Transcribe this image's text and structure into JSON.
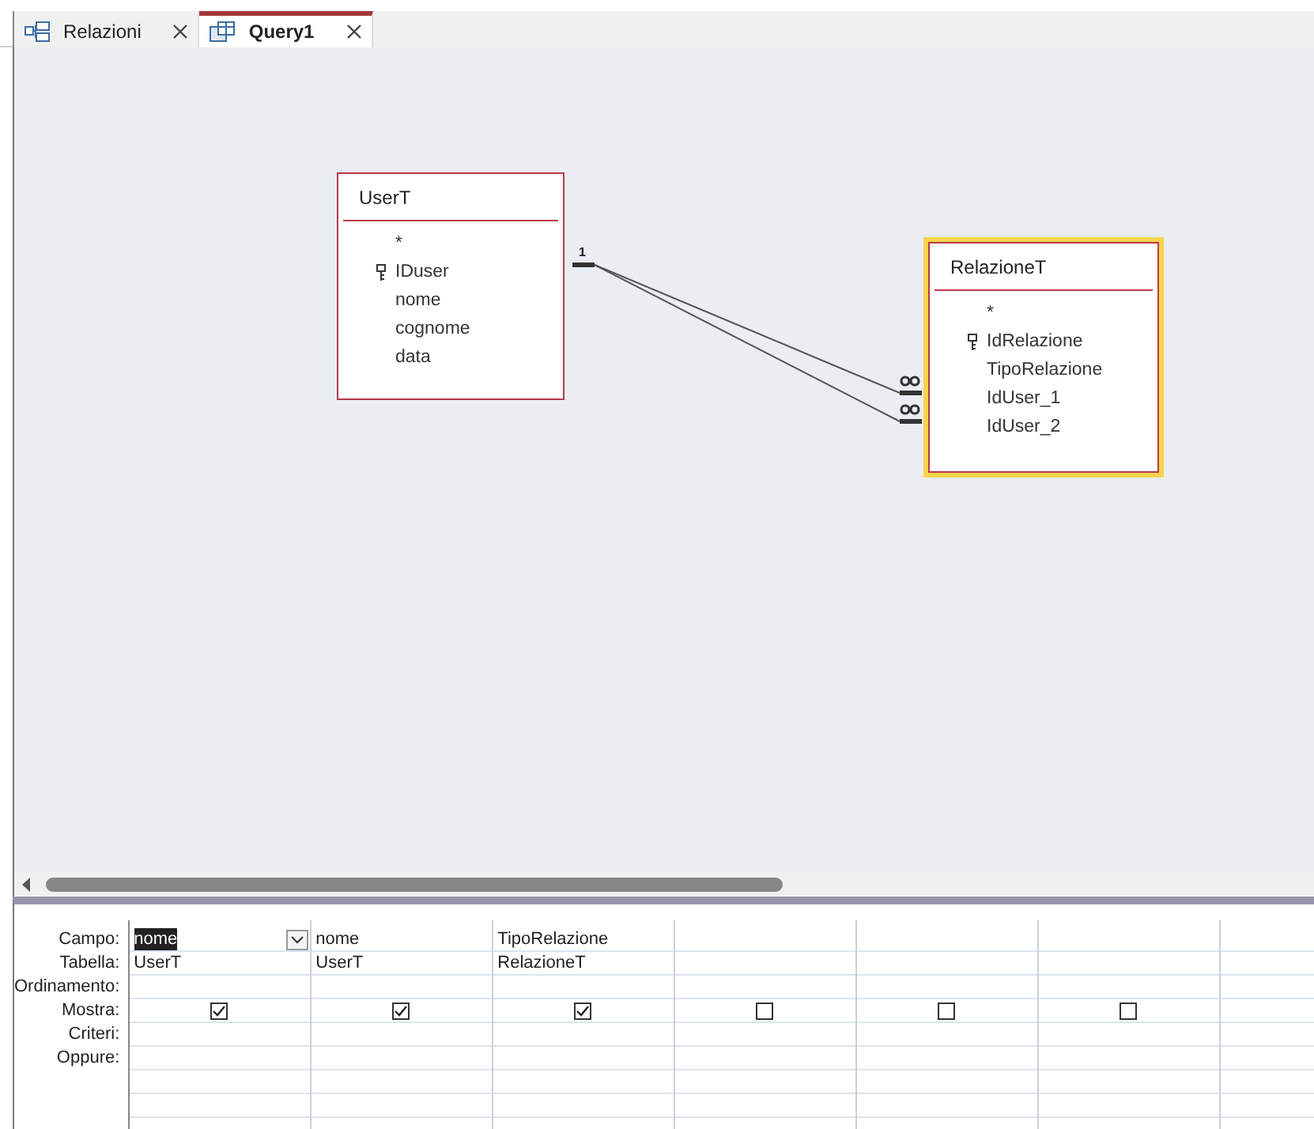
{
  "tabs": [
    {
      "label": "Relazioni",
      "kind": "relationships",
      "selected": false
    },
    {
      "label": "Query1",
      "kind": "query",
      "selected": true
    }
  ],
  "tables": [
    {
      "name": "UserT",
      "selected": false,
      "fields": [
        {
          "name": "*",
          "key": false
        },
        {
          "name": "IDuser",
          "key": true
        },
        {
          "name": "nome",
          "key": false
        },
        {
          "name": "cognome",
          "key": false
        },
        {
          "name": "data",
          "key": false
        }
      ]
    },
    {
      "name": "RelazioneT",
      "selected": true,
      "fields": [
        {
          "name": "*",
          "key": false
        },
        {
          "name": "IdRelazione",
          "key": true
        },
        {
          "name": "TipoRelazione",
          "key": false
        },
        {
          "name": "IdUser_1",
          "key": false
        },
        {
          "name": "IdUser_2",
          "key": false
        }
      ]
    }
  ],
  "relationship": {
    "one_label": "1",
    "joins": [
      {
        "kind": "one-to-many"
      },
      {
        "kind": "one-to-many"
      }
    ]
  },
  "grid": {
    "row_labels": [
      "Campo:",
      "Tabella:",
      "Ordinamento:",
      "Mostra:",
      "Criteri:",
      "Oppure:"
    ],
    "columns": [
      {
        "field": "nome",
        "table": "UserT",
        "show": true,
        "selected": true
      },
      {
        "field": "nome",
        "table": "UserT",
        "show": true,
        "selected": false
      },
      {
        "field": "TipoRelazione",
        "table": "RelazioneT",
        "show": true,
        "selected": false
      },
      {
        "show": false,
        "selected": false
      },
      {
        "show": false,
        "selected": false
      },
      {
        "show": false,
        "selected": false
      }
    ]
  }
}
